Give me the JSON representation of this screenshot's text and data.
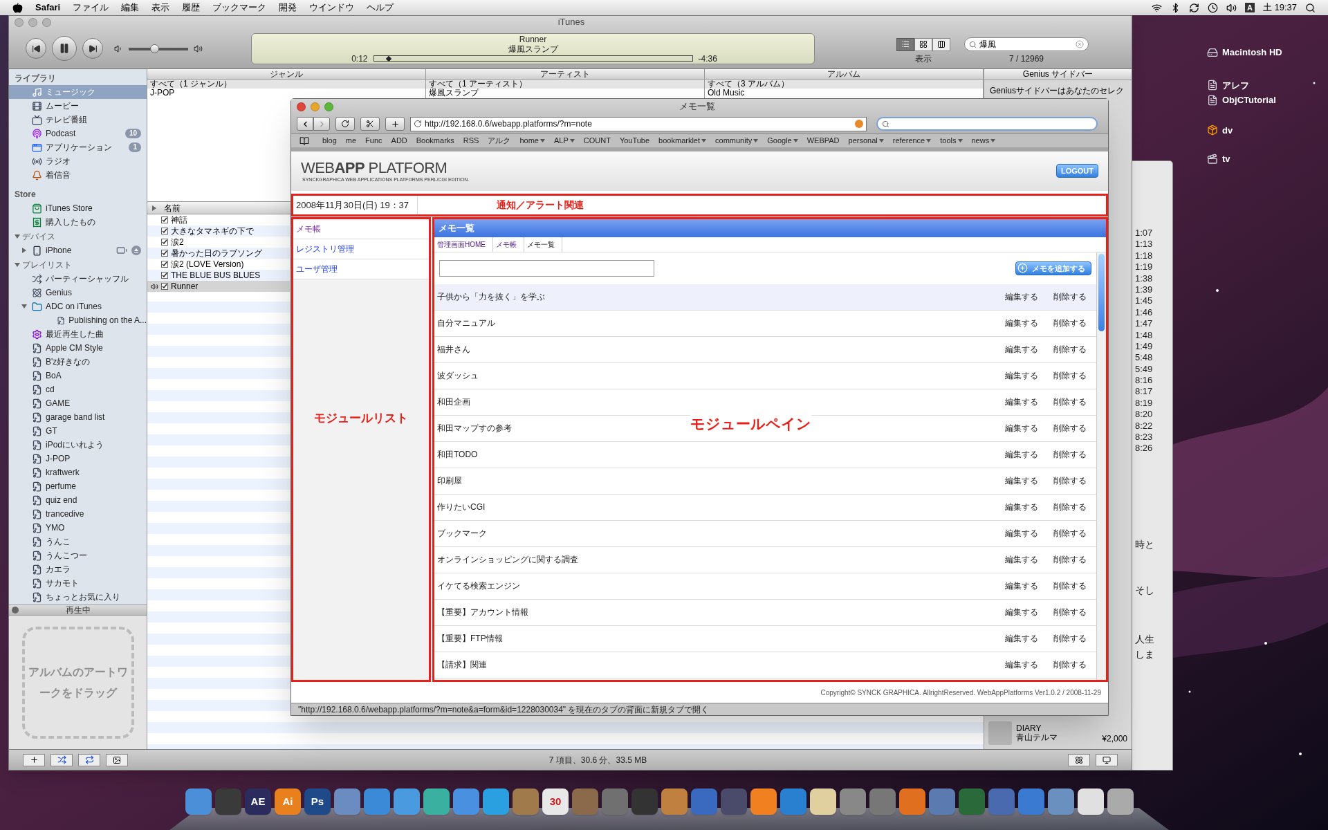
{
  "menu_bar": {
    "app": "Safari",
    "menus": [
      "ファイル",
      "編集",
      "表示",
      "履歴",
      "ブックマーク",
      "開発",
      "ウインドウ",
      "ヘルプ"
    ],
    "input_mode": "A",
    "clock": "土 19:37"
  },
  "desktop_icons": [
    {
      "label": "Macintosh HD",
      "kind": "disk"
    },
    {
      "label": "アレフ",
      "kind": "document"
    },
    {
      "label": "ObjCTutorial",
      "kind": "document"
    },
    {
      "label": "dv",
      "kind": "package"
    },
    {
      "label": "tv",
      "kind": "movie"
    }
  ],
  "background_window": {
    "times": [
      "1:07",
      "1:13",
      "1:18",
      "1:19",
      "1:38",
      "1:39",
      "1:45",
      "1:46",
      "1:47",
      "1:48",
      "1:49",
      "5:48",
      "5:49",
      "8:16",
      "8:17",
      "8:19",
      "8:20",
      "8:22",
      "8:23",
      "8:26"
    ],
    "text_fragments": [
      "時と",
      "そし",
      "人生",
      "しま"
    ]
  },
  "itunes": {
    "title": "iTunes",
    "volume": {
      "level": 0.43
    },
    "now_playing": {
      "song": "Runner",
      "artist": "爆風スランプ",
      "elapsed": "0:12",
      "remaining": "-4:36",
      "level": 0.04
    },
    "view_label": "表示",
    "search": {
      "value": "爆風"
    },
    "result_count": "7 / 12969",
    "sidebar": [
      {
        "heading": "ライブラリ",
        "kind": "plain",
        "items": [
          {
            "label": "ミュージック",
            "kind": "music",
            "selected": true
          },
          {
            "label": "ムービー",
            "kind": "movie",
            "selected": false
          },
          {
            "label": "テレビ番組",
            "kind": "tv",
            "selected": false
          },
          {
            "label": "Podcast",
            "kind": "podcast",
            "selected": false,
            "badge": "10"
          },
          {
            "label": "アプリケーション",
            "kind": "app",
            "selected": false,
            "badge": "1"
          },
          {
            "label": "ラジオ",
            "kind": "radio",
            "selected": false
          },
          {
            "label": "着信音",
            "kind": "ringtone",
            "selected": false
          }
        ]
      },
      {
        "heading": "Store",
        "kind": "plain",
        "items": [
          {
            "label": "iTunes Store",
            "kind": "store",
            "selected": false
          },
          {
            "label": "購入したもの",
            "kind": "purchased",
            "selected": false
          }
        ]
      },
      {
        "heading": "デバイス",
        "kind": "disclosure",
        "expanded": true,
        "items": [
          {
            "label": "iPhone",
            "kind": "device",
            "selected": false,
            "expanded": false
          }
        ]
      },
      {
        "heading": "プレイリスト",
        "kind": "disclosure",
        "expanded": true,
        "items": [
          {
            "label": "パーティーシャッフル",
            "kind": "party",
            "selected": false
          },
          {
            "label": "Genius",
            "kind": "genius",
            "selected": false
          },
          {
            "label": "ADC on iTunes",
            "kind": "folder",
            "selected": false,
            "expanded": true,
            "children": [
              {
                "label": "Publishing on the A...",
                "kind": "playlist",
                "selected": false
              }
            ]
          },
          {
            "label": "最近再生した曲",
            "kind": "smart",
            "selected": false
          },
          {
            "label": "Apple CM Style",
            "kind": "playlist",
            "selected": false
          },
          {
            "label": "B'z好きなの",
            "kind": "playlist",
            "selected": false
          },
          {
            "label": "BoA",
            "kind": "playlist",
            "selected": false
          },
          {
            "label": "cd",
            "kind": "playlist",
            "selected": false
          },
          {
            "label": "GAME",
            "kind": "playlist",
            "selected": false
          },
          {
            "label": "garage band list",
            "kind": "playlist",
            "selected": false
          },
          {
            "label": "GT",
            "kind": "playlist",
            "selected": false
          },
          {
            "label": "iPodにいれよう",
            "kind": "playlist",
            "selected": false
          },
          {
            "label": "J-POP",
            "kind": "playlist",
            "selected": false
          },
          {
            "label": "kraftwerk",
            "kind": "playlist",
            "selected": false
          },
          {
            "label": "perfume",
            "kind": "playlist",
            "selected": false
          },
          {
            "label": "quiz end",
            "kind": "playlist",
            "selected": false
          },
          {
            "label": "trancedive",
            "kind": "playlist",
            "selected": false
          },
          {
            "label": "YMO",
            "kind": "playlist",
            "selected": false
          },
          {
            "label": "うんこ",
            "kind": "playlist",
            "selected": false
          },
          {
            "label": "うんこつー",
            "kind": "playlist",
            "selected": false
          },
          {
            "label": "カエラ",
            "kind": "playlist",
            "selected": false
          },
          {
            "label": "サカモト",
            "kind": "playlist",
            "selected": false
          },
          {
            "label": "ちょっとお気に入り",
            "kind": "playlist",
            "selected": false
          }
        ]
      }
    ],
    "now_playing_panel": {
      "title": "再生中",
      "hint": "アルバムのアートワークをドラッグ"
    },
    "browser_columns": [
      {
        "title": "ジャンル",
        "items": [
          "すべて（1 ジャンル）",
          "J-POP"
        ]
      },
      {
        "title": "アーティスト",
        "items": [
          "すべて（1 アーティスト）",
          "爆風スランプ"
        ]
      },
      {
        "title": "アルバム",
        "items": [
          "すべて（3 アルバム）",
          "Old Music"
        ]
      }
    ],
    "song_list": {
      "column": "名前",
      "songs": [
        {
          "name": "神話",
          "checked": true,
          "playing": false
        },
        {
          "name": "大きなタマネギの下で",
          "checked": true,
          "playing": false
        },
        {
          "name": "涙2",
          "checked": true,
          "playing": false
        },
        {
          "name": "暑かった日のラブソング",
          "checked": true,
          "playing": false
        },
        {
          "name": "涙2 (LOVE Version)",
          "checked": true,
          "playing": false
        },
        {
          "name": "THE BLUE BUS BLUES",
          "checked": true,
          "playing": false
        },
        {
          "name": "Runner",
          "checked": true,
          "playing": true
        }
      ]
    },
    "genius_sidebar": {
      "title": "Genius サイドバー",
      "text": "Geniusサイドバーはあなたのセレク",
      "item": {
        "title": "DIARY",
        "artist": "青山テルマ",
        "price": "¥2,000"
      }
    },
    "status": "7 項目、30.6 分、33.5 MB"
  },
  "safari": {
    "title": "メモ一覧",
    "url": "http://192.168.0.6/webapp.platforms/?m=note",
    "bookmarks": [
      {
        "label": "blog",
        "menu": false
      },
      {
        "label": "me",
        "menu": false
      },
      {
        "label": "Func",
        "menu": false
      },
      {
        "label": "ADD",
        "menu": false
      },
      {
        "label": "Bookmarks",
        "menu": false
      },
      {
        "label": "RSS",
        "menu": false
      },
      {
        "label": "アルク",
        "menu": false
      },
      {
        "label": "home",
        "menu": true
      },
      {
        "label": "ALP",
        "menu": true
      },
      {
        "label": "COUNT",
        "menu": false
      },
      {
        "label": "YouTube",
        "menu": false
      },
      {
        "label": "bookmarklet",
        "menu": true
      },
      {
        "label": "community",
        "menu": true
      },
      {
        "label": "Google",
        "menu": true
      },
      {
        "label": "WEBPAD",
        "menu": false
      },
      {
        "label": "personal",
        "menu": true
      },
      {
        "label": "reference",
        "menu": true
      },
      {
        "label": "tools",
        "menu": true
      },
      {
        "label": "news",
        "menu": true
      }
    ],
    "page": {
      "logo": "WEB**APP** PLATFORM",
      "tagline": "SYNCKGRAPHICA WEB APPLICATIONS PLATFORMS PERL/CGI EDITION.",
      "logout": "LOGOUT",
      "date": "2008年11月30日(日) 19：37",
      "notice_note": "通知／アラート関連",
      "modules": [
        {
          "label": "メモ帳",
          "selected": true
        },
        {
          "label": "レジストリ管理",
          "selected": false
        },
        {
          "label": "ユーザ管理",
          "selected": false
        }
      ],
      "module_list_note": "モジュールリスト",
      "pane_title": "メモ一覧",
      "breadcrumb": [
        "管理画面HOME",
        "メモ帳",
        "メモ一覧"
      ],
      "add_button": "メモを追加する",
      "pane_note": "モジュールペイン",
      "memos": [
        {
          "title": "子供から「力を抜く」を学ぶ",
          "edit": "編集する",
          "delete": "削除する",
          "highlighted": true
        },
        {
          "title": "自分マニュアル",
          "edit": "編集する",
          "delete": "削除する",
          "highlighted": false
        },
        {
          "title": "福井さん",
          "edit": "編集する",
          "delete": "削除する",
          "highlighted": false
        },
        {
          "title": "波ダッシュ",
          "edit": "編集する",
          "delete": "削除する",
          "highlighted": false
        },
        {
          "title": "和田企画",
          "edit": "編集する",
          "delete": "削除する",
          "highlighted": false
        },
        {
          "title": "和田マップすの参考",
          "edit": "編集する",
          "delete": "削除する",
          "highlighted": false
        },
        {
          "title": "和田TODO",
          "edit": "編集する",
          "delete": "削除する",
          "highlighted": false
        },
        {
          "title": "印刷屋",
          "edit": "編集する",
          "delete": "削除する",
          "highlighted": false
        },
        {
          "title": "作りたいCGI",
          "edit": "編集する",
          "delete": "削除する",
          "highlighted": false
        },
        {
          "title": "ブックマーク",
          "edit": "編集する",
          "delete": "削除する",
          "highlighted": false
        },
        {
          "title": "オンラインショッピングに関する調査",
          "edit": "編集する",
          "delete": "削除する",
          "highlighted": false
        },
        {
          "title": "イケてる検索エンジン",
          "edit": "編集する",
          "delete": "削除する",
          "highlighted": false
        },
        {
          "title": "【重要】アカウント情報",
          "edit": "編集する",
          "delete": "削除する",
          "highlighted": false
        },
        {
          "title": "【重要】FTP情報",
          "edit": "編集する",
          "delete": "削除する",
          "highlighted": false
        },
        {
          "title": "【請求】関連",
          "edit": "編集する",
          "delete": "削除する",
          "highlighted": false
        }
      ],
      "copyright": "Copyright© SYNCK GRAPHICA. AllrightReserved. WebAppPlatforms Ver1.0.2 / 2008-11-29"
    },
    "status_bar": "\"http://192.168.0.6/webapp.platforms/?m=note&a=form&id=1228030034\" を現在のタブの背面に新規タブで開く"
  },
  "dock": [
    {
      "color": "#4a8fd8"
    },
    {
      "color": "#3a3a3a"
    },
    {
      "color": "#2b2b5e",
      "label": "AE"
    },
    {
      "color": "#e8801e",
      "label": "Ai"
    },
    {
      "color": "#1e4a8a",
      "label": "Ps"
    },
    {
      "color": "#6b8cc0"
    },
    {
      "color": "#3a8ad8"
    },
    {
      "color": "#4a9ae0"
    },
    {
      "color": "#3ab0a0"
    },
    {
      "color": "#4a90e0"
    },
    {
      "color": "#2aa0e0"
    },
    {
      "color": "#a07a4a"
    },
    {
      "color": "#e8e8e8",
      "label": "30"
    },
    {
      "color": "#8a6a4a"
    },
    {
      "color": "#707070"
    },
    {
      "color": "#333333"
    },
    {
      "color": "#c08040"
    },
    {
      "color": "#3a6ac0"
    },
    {
      "color": "#4a4a6a"
    },
    {
      "color": "#f08020"
    },
    {
      "color": "#2a80d0"
    },
    {
      "color": "#e0d0a0"
    },
    {
      "color": "#888888"
    },
    {
      "color": "#777777"
    },
    {
      "color": "#e07020"
    },
    {
      "color": "#5a7ab0"
    },
    {
      "color": "#2a6a3a"
    },
    {
      "color": "#4a6ab0"
    },
    {
      "color": "#3a7ad0"
    },
    {
      "color": "#6a90c0"
    },
    {
      "color": "#e0e0e0"
    },
    {
      "color": "#aaaaaa"
    }
  ]
}
